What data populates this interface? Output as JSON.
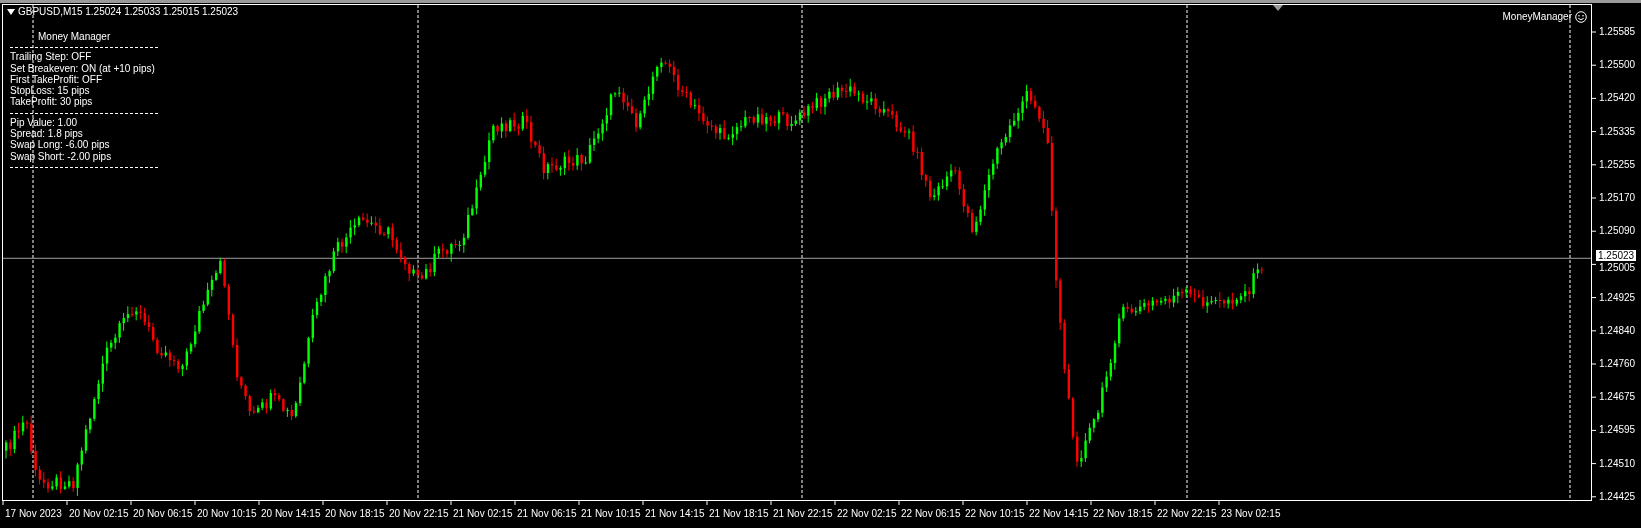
{
  "chart": {
    "header": "GBPUSD,M15  1.25024 1.25033 1.25015 1.25023",
    "indicator_label": "MoneyManager",
    "panel": {
      "title": "Money Manager",
      "groups": [
        [
          "Trailing Step: OFF",
          "Set Breakeven: ON (at +10 pips)",
          "First TakeProfit: OFF",
          "StopLoss: 15 pips",
          "TakeProfit: 30 pips"
        ],
        [
          "Pip Value: 1.00",
          "Spread: 1.8 pips",
          "Swap Long: -6.00 pips",
          "Swap Short: -2.00 pips"
        ]
      ]
    },
    "price_axis": [
      "1.25585",
      "1.25500",
      "1.25420",
      "1.25335",
      "1.25255",
      "1.25170",
      "1.25090",
      "1.25005",
      "1.24925",
      "1.24840",
      "1.24760",
      "1.24675",
      "1.24595",
      "1.24510",
      "1.24425"
    ],
    "current_price": "1.25023",
    "time_axis": [
      "17 Nov 2023",
      "20 Nov 02:15",
      "20 Nov 06:15",
      "20 Nov 10:15",
      "20 Nov 14:15",
      "20 Nov 18:15",
      "20 Nov 22:15",
      "21 Nov 02:15",
      "21 Nov 06:15",
      "21 Nov 10:15",
      "21 Nov 14:15",
      "21 Nov 18:15",
      "21 Nov 22:15",
      "22 Nov 02:15",
      "22 Nov 06:15",
      "22 Nov 10:15",
      "22 Nov 14:15",
      "22 Nov 18:15",
      "22 Nov 22:15",
      "23 Nov 02:15"
    ]
  }
}
